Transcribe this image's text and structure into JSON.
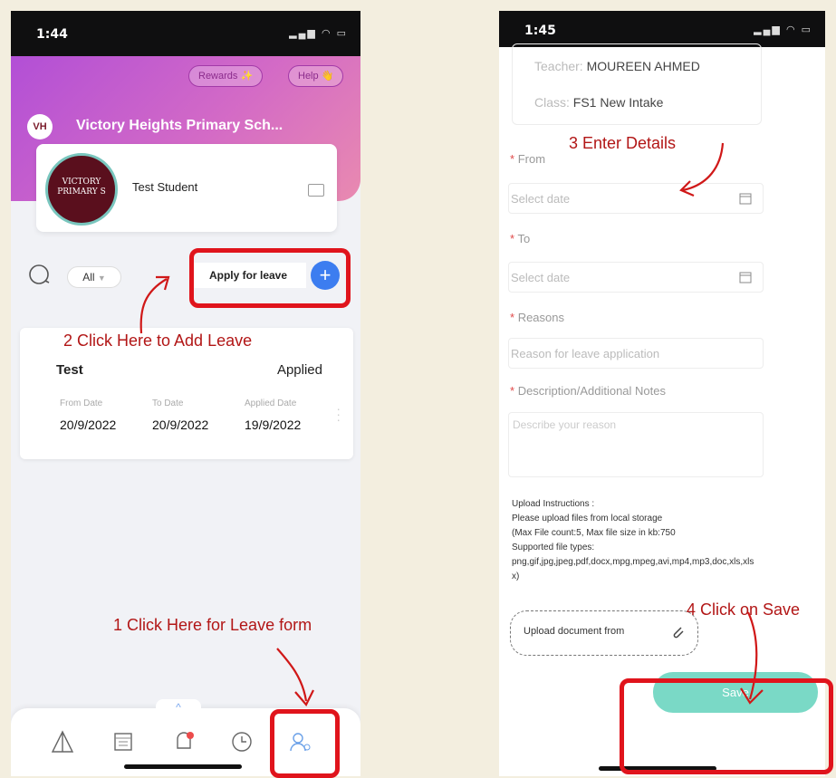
{
  "left": {
    "status_time": "1:44",
    "rewards": "Rewards",
    "help": "Help",
    "school_logo": "VH",
    "school_name": "Victory Heights Primary Sch...",
    "student_name": "Test Student",
    "avatar_text": "VICTORY PRIMARY S",
    "filter": "All",
    "apply_button": "Apply for leave",
    "leave": {
      "title": "Test",
      "status": "Applied",
      "from_label": "From Date",
      "to_label": "To Date",
      "applied_label": "Applied Date",
      "from": "20/9/2022",
      "to": "20/9/2022",
      "applied": "19/9/2022"
    },
    "annotations": {
      "step2": "2 Click Here to Add Leave",
      "step1": "1 Click Here for Leave form"
    }
  },
  "right": {
    "status_time": "1:45",
    "teacher_key": "Teacher:",
    "teacher": "MOUREEN AHMED",
    "class_key": "Class:",
    "class": "FS1 New Intake",
    "from_label": "From",
    "to_label": "To",
    "reasons_label": "Reasons",
    "desc_label": "Description/Additional Notes",
    "date_placeholder": "Select date",
    "reason_placeholder": "Reason for leave application",
    "desc_placeholder": "Describe your reason",
    "instructions": {
      "title": "Upload Instructions :",
      "line1": "Please upload files from local storage",
      "line2": "(Max File count:5, Max file size in kb:750",
      "line3": "Supported file types:",
      "line4": "png,gif,jpg,jpeg,pdf,docx,mpg,mpeg,avi,mp4,mp3,doc,xls,xls",
      "line5": "x)"
    },
    "upload": "Upload document from",
    "save": "Save",
    "annotations": {
      "step3": "3  Enter Details",
      "step4": "4 Click on Save"
    }
  },
  "colors": {
    "accent_purple": "#b24fd6",
    "annotation_red": "#e0141c",
    "save_teal": "#7ad9c6",
    "plus_blue": "#3c7df0"
  }
}
